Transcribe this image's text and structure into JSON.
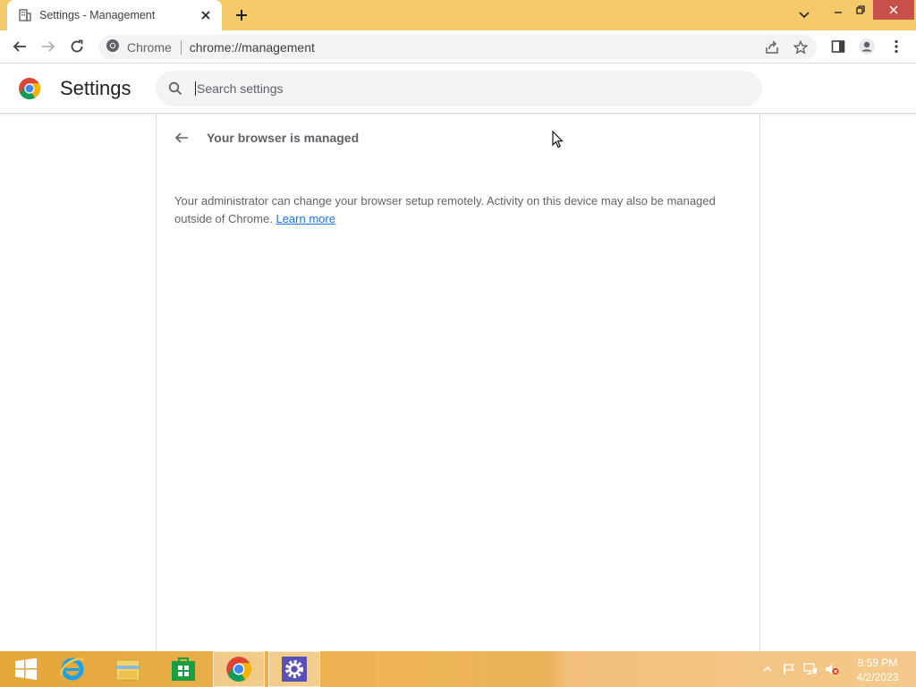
{
  "browser": {
    "tab_title": "Settings - Management",
    "site_chip_label": "Chrome",
    "url": "chrome://management"
  },
  "settings": {
    "title": "Settings",
    "search_placeholder": "Search settings"
  },
  "management": {
    "title": "Your browser is managed",
    "description": "Your administrator can change your browser setup remotely. Activity on this device may also be managed outside of Chrome.",
    "learn_more": "Learn more"
  },
  "taskbar": {
    "time": "8:59 PM",
    "date": "4/2/2023",
    "apps": [
      "start",
      "internet-explorer",
      "file-explorer",
      "store",
      "chrome",
      "settings"
    ]
  },
  "colors": {
    "tabstrip": "#f4c96a",
    "link": "#1a73e8",
    "close_hover": "#c7504a"
  }
}
